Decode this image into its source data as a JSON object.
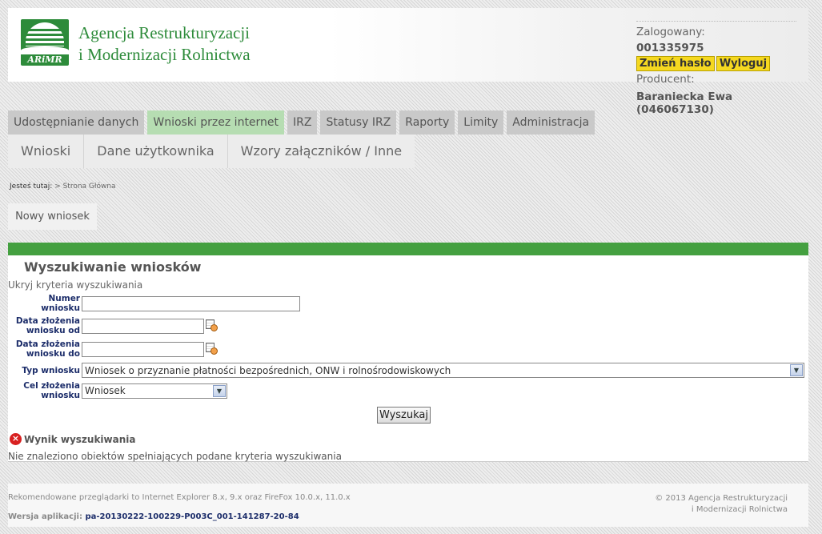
{
  "brand": {
    "logo_abbr": "ARiMR",
    "line1": "Agencja Restrukturyzacji",
    "line2": "i Modernizacji Rolnictwa"
  },
  "user": {
    "logged_label": "Zalogowany:",
    "login_id": "001335975",
    "change_password": "Zmień hasło",
    "logout": "Wyloguj",
    "producer_label": "Producent:",
    "producer_name": "Baraniecka Ewa (046067130)"
  },
  "menu_primary": [
    {
      "label": "Udostępnianie danych",
      "active": false
    },
    {
      "label": "Wnioski przez internet",
      "active": true
    },
    {
      "label": "IRZ",
      "active": false
    },
    {
      "label": "Statusy IRZ",
      "active": false
    },
    {
      "label": "Raporty",
      "active": false
    },
    {
      "label": "Limity",
      "active": false
    },
    {
      "label": "Administracja",
      "active": false
    }
  ],
  "menu_secondary": [
    {
      "label": "Wnioski"
    },
    {
      "label": "Dane użytkownika"
    },
    {
      "label": "Wzory załączników / Inne"
    }
  ],
  "breadcrumb": {
    "prefix": "Jesteś tutaj:",
    "current": "> Strona Główna"
  },
  "new_request_button": "Nowy wniosek",
  "search": {
    "title": "Wyszukiwanie wniosków",
    "toggle": "Ukryj kryteria wyszukiwania",
    "fields": {
      "number_label_1": "Numer",
      "number_label_2": "wniosku",
      "number_value": "",
      "date_from_label_1": "Data złożenia",
      "date_from_label_2": "wniosku od",
      "date_from_value": "",
      "date_to_label_1": "Data złożenia",
      "date_to_label_2": "wniosku do",
      "date_to_value": "",
      "type_label": "Typ wniosku",
      "type_value": "Wniosek o przyznanie płatności bezpośrednich, ONW i rolnośrodowiskowych",
      "purpose_label_1": "Cel złożenia",
      "purpose_label_2": "wniosku",
      "purpose_value": "Wniosek"
    },
    "button": "Wyszukaj",
    "result_title": "Wynik wyszukiwania",
    "no_results": "Nie znaleziono obiektów spełniających podane kryteria wyszukiwania"
  },
  "footer": {
    "recommended": "Rekomendowane przeglądarki to Internet Explorer 8.x, 9.x oraz FireFox 10.0.x, 11.0.x",
    "version_label": "Wersja aplikacji:",
    "version_value": "pa-20130222-100229-P003C_001-141287-20-84",
    "copyright_1": "© 2013 Agencja Restrukturyzacji",
    "copyright_2": "i Modernizacji Rolnictwa"
  },
  "colors": {
    "accent_green": "#44a040",
    "active_tab": "#b6ddb2",
    "action_yellow": "#f5d820",
    "label_navy": "#1c2d6a"
  },
  "icons": [
    "arimr-logo-icon",
    "calendar-icon",
    "chevron-down-icon",
    "error-icon"
  ]
}
